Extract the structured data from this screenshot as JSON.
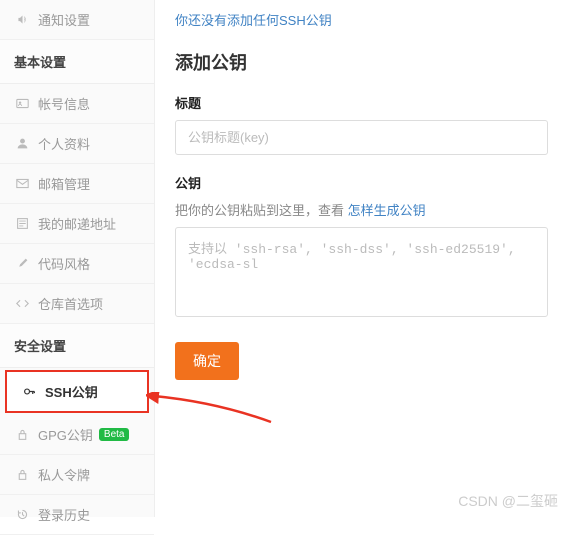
{
  "sidebar": {
    "notify_settings": "通知设置",
    "basic_header": "基本设置",
    "account_info": "帐号信息",
    "profile": "个人资料",
    "email_mgmt": "邮箱管理",
    "my_email_addr": "我的邮递地址",
    "code_style": "代码风格",
    "repo_pref": "仓库首选项",
    "security_header": "安全设置",
    "ssh_keys": "SSH公钥",
    "gpg_keys": "GPG公钥",
    "gpg_badge": "Beta",
    "tokens": "私人令牌",
    "login_history": "登录历史"
  },
  "main": {
    "banner": "你还没有添加任何SSH公钥",
    "heading": "添加公钥",
    "title_label": "标题",
    "title_placeholder": "公钥标题(key)",
    "title_value": "",
    "key_label": "公钥",
    "hint_prefix": "把你的公钥粘贴到这里，查看 ",
    "hint_link": "怎样生成公钥",
    "key_placeholder": "支持以 'ssh-rsa', 'ssh-dss', 'ssh-ed25519', 'ecdsa-sl",
    "key_value": "",
    "submit": "确定"
  },
  "watermark": "CSDN @二玺砸",
  "colors": {
    "accent": "#f2711c",
    "link": "#4183c4",
    "highlight_border": "#e93323",
    "badge": "#21ba45"
  }
}
